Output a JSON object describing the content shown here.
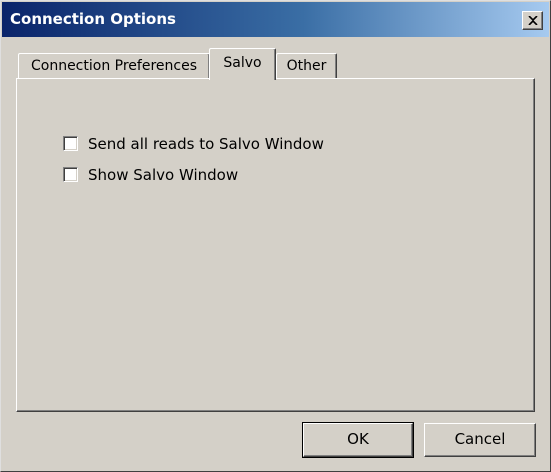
{
  "window": {
    "title": "Connection Options",
    "close_icon": "close-icon"
  },
  "tabs": [
    {
      "label": "Connection Preferences",
      "selected": false
    },
    {
      "label": "Salvo",
      "selected": true
    },
    {
      "label": "Other",
      "selected": false
    }
  ],
  "salvo_page": {
    "options": [
      {
        "label": "Send all reads to Salvo Window",
        "checked": false
      },
      {
        "label": "Show Salvo Window",
        "checked": false
      }
    ]
  },
  "buttons": {
    "ok_label": "OK",
    "cancel_label": "Cancel"
  }
}
